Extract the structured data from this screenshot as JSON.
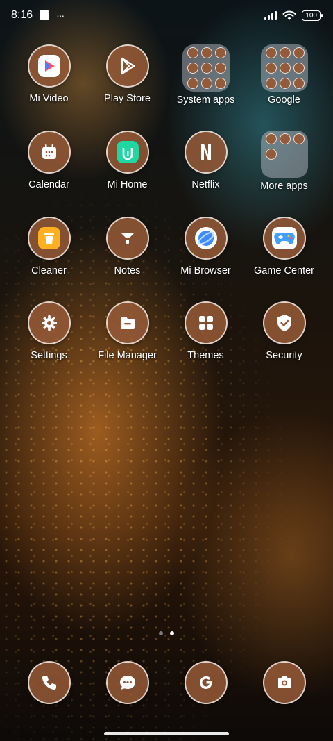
{
  "status_bar": {
    "time": "8:16",
    "more": "···",
    "battery": "100"
  },
  "apps": [
    {
      "label": "Mi Video",
      "icon": "play-triangle-icon",
      "type": "app",
      "color": "#ff4d6d"
    },
    {
      "label": "Play Store",
      "icon": "play-store-icon",
      "type": "app",
      "color": "#ffffff"
    },
    {
      "label": "System apps",
      "icon": "folder-icon",
      "type": "folder"
    },
    {
      "label": "Google",
      "icon": "folder-icon",
      "type": "folder"
    },
    {
      "label": "Calendar",
      "icon": "calendar-icon",
      "type": "app",
      "color": "#ffffff"
    },
    {
      "label": "Mi Home",
      "icon": "mi-home-icon",
      "type": "app",
      "color": "#1fd7a0"
    },
    {
      "label": "Netflix",
      "icon": "netflix-icon",
      "type": "app",
      "color": "#ffffff"
    },
    {
      "label": "More apps",
      "icon": "folder-icon",
      "type": "folder"
    },
    {
      "label": "Cleaner",
      "icon": "trash-can-icon",
      "type": "app",
      "color": "#ffb020"
    },
    {
      "label": "Notes",
      "icon": "notes-funnel-icon",
      "type": "app",
      "color": "#ffffff"
    },
    {
      "label": "Mi Browser",
      "icon": "browser-planet-icon",
      "type": "app",
      "color": "#3d8bff"
    },
    {
      "label": "Game Center",
      "icon": "gamepad-icon",
      "type": "app",
      "color": "#3fa0ff"
    },
    {
      "label": "Settings",
      "icon": "gear-icon",
      "type": "app",
      "color": "#ffffff"
    },
    {
      "label": "File Manager",
      "icon": "folder-file-icon",
      "type": "app",
      "color": "#ffffff"
    },
    {
      "label": "Themes",
      "icon": "themes-grid-icon",
      "type": "app",
      "color": "#ffffff"
    },
    {
      "label": "Security",
      "icon": "shield-check-icon",
      "type": "app",
      "color": "#ffffff"
    }
  ],
  "dock": [
    {
      "icon": "phone-icon"
    },
    {
      "icon": "messages-icon"
    },
    {
      "icon": "google-g-icon"
    },
    {
      "icon": "camera-icon"
    }
  ],
  "page_indicator": {
    "pages": 2,
    "current": 2
  }
}
